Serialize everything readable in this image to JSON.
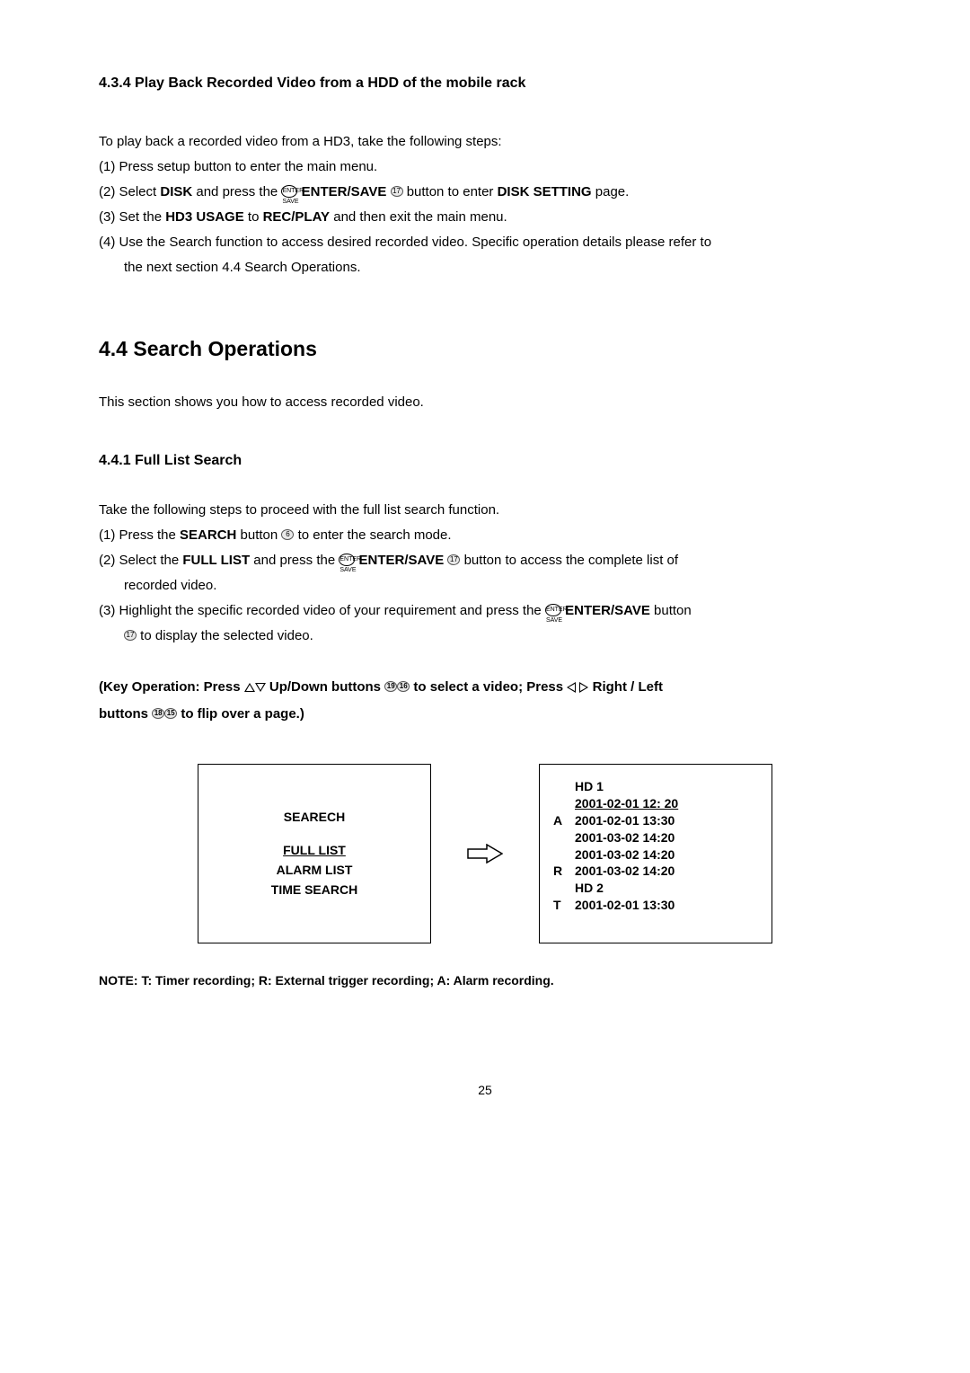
{
  "section434": {
    "title": "4.3.4 Play Back Recorded Video from a HDD of the mobile rack",
    "intro": "To play back a recorded video from a HD3, take the following steps:",
    "step1": "(1) Press setup button to enter the main menu.",
    "step2a": "(2) Select ",
    "step2b": "DISK",
    "step2c": " and press the",
    "step2d": " ENTER/SAVE ",
    "step2e": " button to enter ",
    "step2f": "DISK SETTING",
    "step2g": " page.",
    "step3a": "(3) Set the ",
    "step3b": "HD3 USAGE",
    "step3c": " to ",
    "step3d": "REC/PLAY",
    "step3e": " and then exit the main menu.",
    "step4a": "(4) Use the Search function to access desired recorded video. Specific operation details please refer to",
    "step4b": "the next section 4.4 Search Operations."
  },
  "section44": {
    "title": "4.4 Search Operations",
    "intro": "This section shows you how to access recorded video."
  },
  "section441": {
    "title": "4.4.1 Full List Search",
    "intro": "Take the following steps to proceed with the full list search function.",
    "step1a": "(1) Press the ",
    "step1b": "SEARCH",
    "step1c": " button ",
    "step1d": " to enter the search mode.",
    "step2a": "(2) Select the ",
    "step2b": "FULL LIST",
    "step2c": " and press the ",
    "step2d": " ENTER/SAVE ",
    "step2e": " button to access the complete list of",
    "step2f": "recorded video.",
    "step3a": "(3) Highlight the specific recorded video of your requirement and press the ",
    "step3b": " ENTER/SAVE",
    "step3c": " button",
    "step3d": " to display the selected video."
  },
  "keyop": {
    "part1": "(Key Operation: Press ",
    "part2": " Up/Down buttons ",
    "part3": " to select a video; Press ",
    "part4": " Right / Left",
    "part5": "buttons ",
    "part6": " to flip over a page.)"
  },
  "icons": {
    "enter_save_label": "ENTER\nSAVE",
    "n6": "6",
    "n17": "17",
    "n18": "18",
    "n19": "19",
    "n15": "15",
    "n16": "16"
  },
  "diagram": {
    "left": {
      "title": "SEARECH",
      "item1": "FULL LIST",
      "item2": "ALARM LIST",
      "item3": "TIME SEARCH"
    },
    "right": {
      "hd1": "HD 1",
      "header": "2001-02-01 12: 20",
      "rows": [
        {
          "tag": "A",
          "text": "2001-02-01 13:30"
        },
        {
          "tag": "",
          "text": "2001-03-02 14:20"
        },
        {
          "tag": "",
          "text": "2001-03-02 14:20"
        },
        {
          "tag": "R",
          "text": "2001-03-02 14:20"
        },
        {
          "tag": "",
          "text": "HD 2"
        },
        {
          "tag": "T",
          "text": "2001-02-01 13:30"
        }
      ]
    }
  },
  "note": "NOTE:  T: Timer recording; R: External trigger recording; A: Alarm recording.",
  "page": "25"
}
